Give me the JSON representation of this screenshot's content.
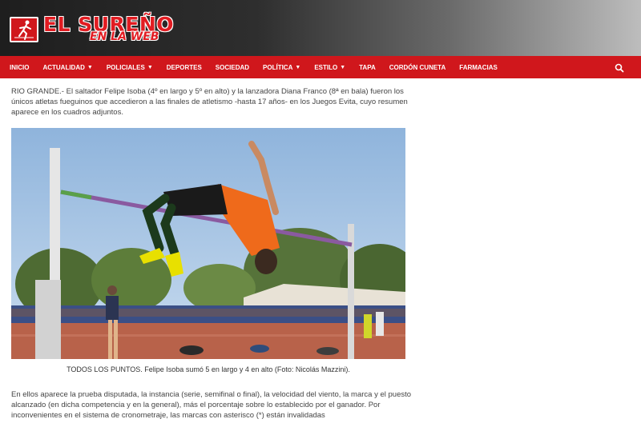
{
  "site": {
    "title": "EL SUREÑO",
    "subtitle": "EN LA WEB"
  },
  "nav": {
    "items": [
      {
        "label": "INICIO",
        "dropdown": false
      },
      {
        "label": "ACTUALIDAD",
        "dropdown": true
      },
      {
        "label": "POLICIALES",
        "dropdown": true
      },
      {
        "label": "DEPORTES",
        "dropdown": false
      },
      {
        "label": "SOCIEDAD",
        "dropdown": false
      },
      {
        "label": "POLÍTICA",
        "dropdown": true
      },
      {
        "label": "ESTILO",
        "dropdown": true
      },
      {
        "label": "TAPA",
        "dropdown": false
      },
      {
        "label": "CORDÓN CUNETA",
        "dropdown": false
      },
      {
        "label": "FARMACIAS",
        "dropdown": false
      }
    ],
    "search_icon": "search-icon"
  },
  "article": {
    "lead_line1": "RIO GRANDE.- El saltador Felipe Isoba (4º en largo y 5º en alto) y la lanzadora Diana Franco (8ª en bala) fueron los",
    "lead_line2": "únicos atletas fueguinos que accedieron a las finales de atletismo -hasta 17 años- en los Juegos Evita, cuyo resumen",
    "lead_line3": "aparece en los cuadros adjuntos.",
    "image_caption": "TODOS LOS PUNTOS. Felipe Isoba sumó 5 en largo y 4 en alto (Foto: Nicolás Mazzini).",
    "body_line1": "En ellos aparece la prueba disputada, la instancia (serie, semifinal o final), la velocidad del viento, la marca y el puesto",
    "body_line2": "alcanzado (en dicha competencia y en la general), más el porcentaje sobre lo establecido por el ganador. Por",
    "body_line3": "inconvenientes en el sistema de cronometraje, las marcas con asterisco (*) están invalidadas"
  },
  "colors": {
    "brand_red": "#d0171c",
    "header_dark": "#1e1e1e"
  }
}
